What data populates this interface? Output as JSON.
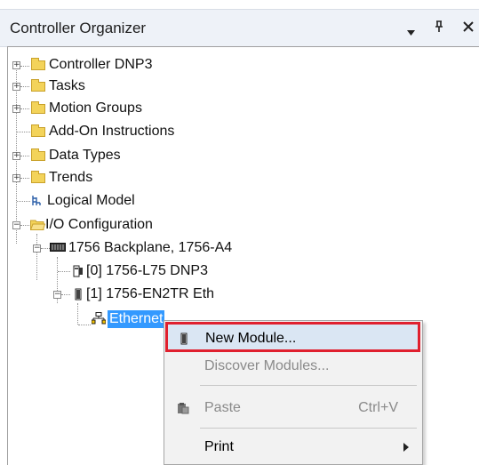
{
  "panel": {
    "title": "Controller Organizer",
    "dropdown_glyph": "▾",
    "pin_glyph": "ᵖ",
    "close_glyph": "✕"
  },
  "tree": {
    "items": [
      {
        "label": "Controller DNP3",
        "icon": "folder-icon",
        "expander": "+"
      },
      {
        "label": "Tasks",
        "icon": "folder-icon",
        "expander": "+"
      },
      {
        "label": "Motion Groups",
        "icon": "folder-icon",
        "expander": "+"
      },
      {
        "label": "Add-On Instructions",
        "icon": "folder-icon",
        "expander": ""
      },
      {
        "label": "Data Types",
        "icon": "folder-icon",
        "expander": "+"
      },
      {
        "label": "Trends",
        "icon": "folder-icon",
        "expander": "+"
      },
      {
        "label": "Logical Model",
        "icon": "logical-model-icon",
        "expander": ""
      },
      {
        "label": "I/O Configuration",
        "icon": "open-folder-icon",
        "expander": "−"
      },
      {
        "label": "1756 Backplane, 1756-A4",
        "icon": "backplane-icon",
        "expander": "−"
      },
      {
        "label": "[0] 1756-L75 DNP3",
        "icon": "controller-module-icon",
        "expander": ""
      },
      {
        "label": "[1] 1756-EN2TR Eth",
        "icon": "ethernet-module-icon",
        "expander": "−"
      },
      {
        "label": "Ethernet",
        "icon": "network-icon",
        "expander": "",
        "selected": true
      }
    ]
  },
  "context_menu": {
    "items": [
      {
        "label": "New Module...",
        "shortcut": "",
        "icon": "module-icon",
        "highlighted": true,
        "enabled": true
      },
      {
        "label": "Discover Modules...",
        "shortcut": "",
        "icon": "",
        "enabled": false
      },
      {
        "label": "Paste",
        "shortcut": "Ctrl+V",
        "icon": "paste-icon",
        "enabled": false
      },
      {
        "label": "Print",
        "shortcut": "",
        "icon": "",
        "enabled": true,
        "submenu": true
      }
    ]
  },
  "colors": {
    "selection": "#3399ff",
    "highlight_outline": "#e0202e",
    "folder": "#f3d35a"
  }
}
